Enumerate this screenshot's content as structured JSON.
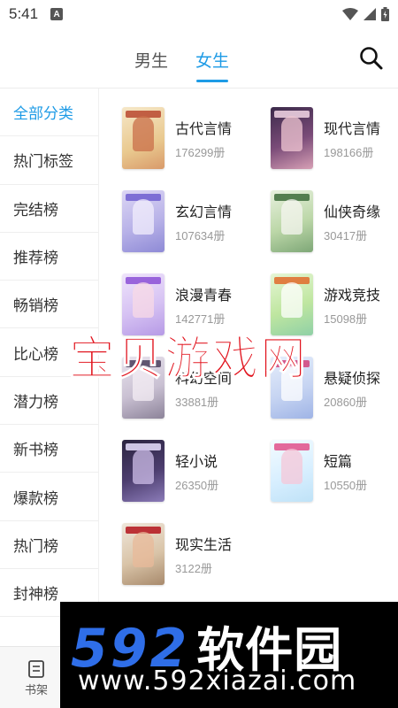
{
  "status_bar": {
    "time": "5:41",
    "app_badge": "A"
  },
  "header": {
    "tabs": [
      {
        "label": "男生",
        "active": false
      },
      {
        "label": "女生",
        "active": true
      }
    ],
    "accent_color": "#1e9be6"
  },
  "sidebar": {
    "items": [
      {
        "label": "全部分类",
        "active": true
      },
      {
        "label": "热门标签"
      },
      {
        "label": "完结榜"
      },
      {
        "label": "推荐榜"
      },
      {
        "label": "畅销榜"
      },
      {
        "label": "比心榜"
      },
      {
        "label": "潜力榜"
      },
      {
        "label": "新书榜"
      },
      {
        "label": "爆款榜"
      },
      {
        "label": "热门榜"
      },
      {
        "label": "封神榜"
      }
    ]
  },
  "categories": [
    {
      "name": "古代言情",
      "count": "176299册"
    },
    {
      "name": "现代言情",
      "count": "198166册"
    },
    {
      "name": "玄幻言情",
      "count": "107634册"
    },
    {
      "name": "仙侠奇缘",
      "count": "30417册"
    },
    {
      "name": "浪漫青春",
      "count": "142771册"
    },
    {
      "name": "游戏竞技",
      "count": "15098册"
    },
    {
      "name": "科幻空间",
      "count": "33881册"
    },
    {
      "name": "悬疑侦探",
      "count": "20860册"
    },
    {
      "name": "轻小说",
      "count": "26350册"
    },
    {
      "name": "短篇",
      "count": "10550册"
    },
    {
      "name": "现实生活",
      "count": "3122册"
    }
  ],
  "bottom_nav": {
    "shelf_label": "书架"
  },
  "watermarks": {
    "red_text": "宝贝游戏网",
    "logo_digits": "592",
    "logo_cn": "软件园",
    "url": "www.592xiazai.com"
  }
}
